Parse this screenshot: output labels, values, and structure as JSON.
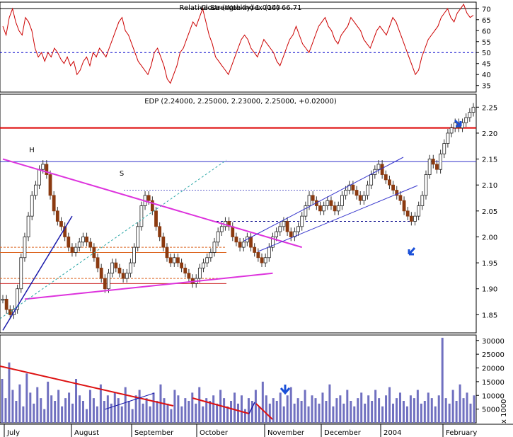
{
  "chart_data": {
    "type": "candlestick",
    "panels": {
      "rsi": {
        "title": "Relative Strength Index (14) 66.71",
        "title_overlap_text": "Close (Weekly) 1.0000",
        "yticks": [
          35,
          40,
          45,
          50,
          55,
          60,
          65,
          70
        ],
        "ylim": [
          32,
          73
        ],
        "reference_lines": [
          70,
          50
        ],
        "values": [
          62,
          58,
          66,
          70,
          64,
          60,
          58,
          66,
          64,
          60,
          52,
          48,
          50,
          46,
          50,
          48,
          52,
          50,
          47,
          45,
          48,
          44,
          46,
          40,
          42,
          46,
          48,
          44,
          50,
          48,
          52,
          50,
          48,
          52,
          56,
          60,
          64,
          66,
          60,
          58,
          54,
          50,
          46,
          44,
          42,
          40,
          44,
          50,
          52,
          48,
          44,
          38,
          36,
          40,
          44,
          50,
          52,
          56,
          60,
          64,
          62,
          66,
          70,
          64,
          58,
          54,
          48,
          46,
          44,
          42,
          40,
          44,
          48,
          52,
          56,
          58,
          56,
          52,
          50,
          48,
          52,
          56,
          54,
          52,
          50,
          46,
          44,
          48,
          52,
          56,
          58,
          62,
          58,
          54,
          52,
          50,
          54,
          58,
          62,
          64,
          66,
          62,
          60,
          56,
          54,
          58,
          60,
          62,
          66,
          64,
          62,
          60,
          56,
          54,
          52,
          56,
          60,
          62,
          60,
          58,
          62,
          66,
          64,
          60,
          56,
          52,
          48,
          44,
          40,
          42,
          48,
          52,
          56,
          58,
          60,
          62,
          66,
          68,
          70,
          66,
          64,
          68,
          70,
          72,
          68,
          66,
          67
        ]
      },
      "price": {
        "title": "EDP (2.24000, 2.25000, 2.23000, 2.25000, +0.02000)",
        "yticks": [
          1.85,
          1.9,
          1.95,
          2.0,
          2.05,
          2.1,
          2.15,
          2.2,
          2.25
        ],
        "ylim": [
          1.815,
          2.275
        ],
        "pattern_labels": [
          "H",
          "S"
        ],
        "series": [
          {
            "name": "price",
            "values": [
              1.88,
              1.86,
              1.85,
              1.86,
              1.9,
              1.96,
              2.0,
              2.04,
              2.08,
              2.1,
              2.13,
              2.14,
              2.12,
              2.08,
              2.05,
              2.03,
              2.02,
              2.0,
              1.98,
              1.97,
              1.98,
              1.99,
              2.0,
              1.99,
              1.98,
              1.96,
              1.94,
              1.92,
              1.9,
              1.93,
              1.95,
              1.94,
              1.93,
              1.92,
              1.93,
              1.95,
              1.98,
              2.02,
              2.06,
              2.08,
              2.07,
              2.05,
              2.02,
              2.0,
              1.98,
              1.96,
              1.95,
              1.96,
              1.95,
              1.94,
              1.93,
              1.92,
              1.91,
              1.92,
              1.94,
              1.95,
              1.96,
              1.97,
              1.99,
              2.01,
              2.02,
              2.03,
              2.02,
              2.0,
              1.99,
              1.98,
              1.99,
              2.0,
              1.98,
              1.97,
              1.96,
              1.95,
              1.96,
              1.98,
              2.0,
              2.01,
              2.02,
              2.03,
              2.01,
              2.0,
              2.01,
              2.02,
              2.04,
              2.06,
              2.08,
              2.07,
              2.06,
              2.05,
              2.06,
              2.07,
              2.06,
              2.05,
              2.06,
              2.08,
              2.09,
              2.1,
              2.09,
              2.08,
              2.07,
              2.08,
              2.1,
              2.12,
              2.13,
              2.14,
              2.12,
              2.11,
              2.1,
              2.09,
              2.08,
              2.07,
              2.05,
              2.04,
              2.03,
              2.04,
              2.06,
              2.08,
              2.12,
              2.15,
              2.14,
              2.13,
              2.16,
              2.18,
              2.2,
              2.21,
              2.22,
              2.21,
              2.22,
              2.23,
              2.24,
              2.25
            ]
          }
        ],
        "horizontal_levels": [
          2.21,
          2.145,
          2.09,
          2.03,
          1.98,
          1.97,
          1.95,
          1.92,
          1.91
        ],
        "annotations": {
          "neckline_trend": [
            [
              0,
              2.15
            ],
            [
              82,
              1.98
            ]
          ],
          "lower_trend": [
            [
              6,
              1.88
            ],
            [
              74,
              1.93
            ]
          ],
          "blue_trend": [
            [
              0,
              1.82
            ],
            [
              19,
              2.04
            ]
          ]
        }
      },
      "volume": {
        "yticks": [
          5000,
          10000,
          15000,
          20000,
          25000,
          30000
        ],
        "ylim": [
          0,
          32000
        ],
        "unit_label": "x 1000",
        "values": [
          16000,
          9000,
          22000,
          12000,
          8000,
          14000,
          6000,
          18000,
          11000,
          7000,
          13000,
          9000,
          5000,
          15000,
          10000,
          8000,
          12000,
          6000,
          9000,
          11000,
          7000,
          16000,
          10000,
          8000,
          5000,
          12000,
          9000,
          6000,
          14000,
          8000,
          10000,
          7000,
          11000,
          9000,
          6000,
          13000,
          8000,
          5000,
          10000,
          12000,
          7000,
          9000,
          6000,
          11000,
          8000,
          14000,
          9000,
          7000,
          5000,
          12000,
          10000,
          6000,
          9000,
          8000,
          11000,
          7000,
          13000,
          6000,
          9000,
          8000,
          10000,
          7000,
          12000,
          9000,
          6000,
          8000,
          11000,
          7000,
          10000,
          5000,
          9000,
          8000,
          12000,
          6000,
          15000,
          10000,
          7000,
          9000,
          8000,
          11000,
          6000,
          10000,
          13000,
          7000,
          9000,
          8000,
          12000,
          6000,
          10000,
          9000,
          7000,
          11000,
          8000,
          14000,
          6000,
          9000,
          10000,
          7000,
          12000,
          8000,
          6000,
          9000,
          11000,
          7000,
          10000,
          8000,
          12000,
          9000,
          6000,
          10000,
          13000,
          7000,
          9000,
          11000,
          8000,
          6000,
          10000,
          9000,
          12000,
          7000,
          8000,
          11000,
          9000,
          6000,
          10000,
          31000,
          9000,
          7000,
          12000,
          8000,
          14000,
          9000,
          11000,
          7000,
          10000
        ]
      }
    },
    "xaxis_labels": [
      "July",
      "August",
      "September",
      "October",
      "November",
      "December",
      "2004",
      "February"
    ]
  }
}
